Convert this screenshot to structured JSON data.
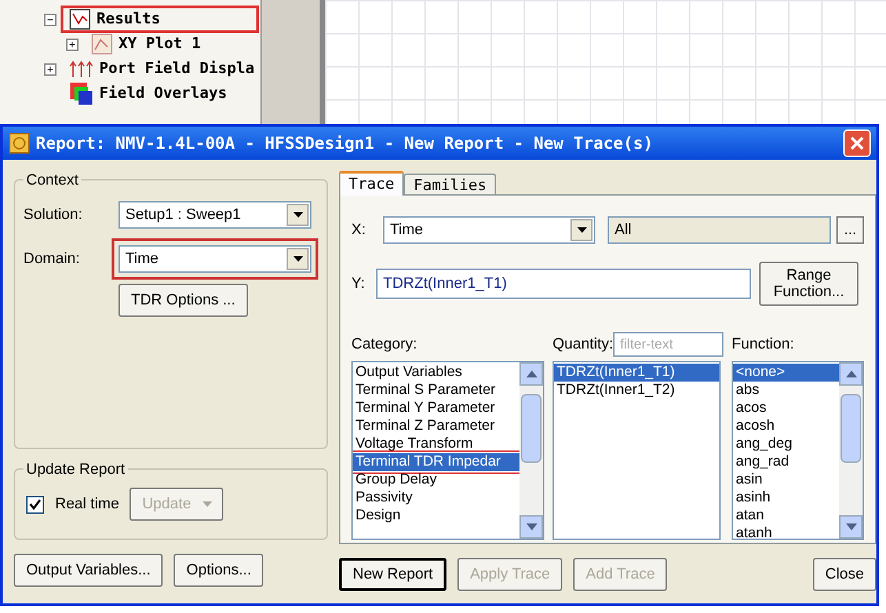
{
  "tree": {
    "items": [
      {
        "label": "Results",
        "expander": "−",
        "annotated": true,
        "kind": "results",
        "children": [
          {
            "label": "XY Plot 1",
            "expander": "+",
            "annotated": false,
            "kind": "plot"
          }
        ]
      },
      {
        "label": "Port Field Displa",
        "expander": "+",
        "annotated": false,
        "kind": "port"
      },
      {
        "label": "Field Overlays",
        "annotated": false,
        "kind": "overlay"
      }
    ]
  },
  "dialog": {
    "title": "Report: NMV-1.4L-00A - HFSSDesign1 - New Report - New Trace(s)",
    "context": {
      "title": "Context",
      "solution": {
        "label": "Solution:",
        "value": "Setup1 : Sweep1"
      },
      "domain": {
        "label": "Domain:",
        "value": "Time",
        "annotated": true
      },
      "tdr_button": "TDR Options ..."
    },
    "update": {
      "title": "Update Report",
      "realtime": {
        "label": "Real time",
        "checked": true
      },
      "update_button": {
        "label": "Update",
        "disabled": true
      }
    },
    "tabs": [
      {
        "label": "Trace",
        "selected": true
      },
      {
        "label": "Families",
        "selected": false
      }
    ],
    "x": {
      "label": "X:",
      "value": "Time",
      "range": "All",
      "more": "..."
    },
    "y": {
      "label": "Y:",
      "value": "TDRZt(Inner1_T1)",
      "range_button": "Range Function..."
    },
    "category": {
      "label": "Category:",
      "items": [
        {
          "label": "Output Variables",
          "selected": false,
          "annotated": false
        },
        {
          "label": "Terminal S Parameter",
          "selected": false,
          "annotated": false
        },
        {
          "label": "Terminal Y Parameter",
          "selected": false,
          "annotated": false
        },
        {
          "label": "Terminal Z Parameter",
          "selected": false,
          "annotated": false
        },
        {
          "label": "Voltage Transform",
          "selected": false,
          "annotated": false
        },
        {
          "label": "Terminal TDR Impedar",
          "selected": true,
          "annotated": true
        },
        {
          "label": "Group Delay",
          "selected": false,
          "annotated": false
        },
        {
          "label": "Passivity",
          "selected": false,
          "annotated": false
        },
        {
          "label": "Design",
          "selected": false,
          "annotated": false
        }
      ]
    },
    "quantity": {
      "label": "Quantity:",
      "placeholder": "filter-text",
      "items": [
        {
          "label": "TDRZt(Inner1_T1)",
          "selected": true
        },
        {
          "label": "TDRZt(Inner1_T2)",
          "selected": false
        }
      ]
    },
    "function": {
      "label": "Function:",
      "items": [
        {
          "label": "<none>",
          "selected": true
        },
        {
          "label": "abs",
          "selected": false
        },
        {
          "label": "acos",
          "selected": false
        },
        {
          "label": "acosh",
          "selected": false
        },
        {
          "label": "ang_deg",
          "selected": false
        },
        {
          "label": "ang_rad",
          "selected": false
        },
        {
          "label": "asin",
          "selected": false
        },
        {
          "label": "asinh",
          "selected": false
        },
        {
          "label": "atan",
          "selected": false
        },
        {
          "label": "atanh",
          "selected": false
        }
      ]
    },
    "left_buttons": [
      {
        "label": "Output Variables...",
        "disabled": false,
        "default": false
      },
      {
        "label": "Options...",
        "disabled": false,
        "default": false
      }
    ],
    "right_buttons": [
      {
        "label": "New Report",
        "disabled": false,
        "default": true
      },
      {
        "label": "Apply Trace",
        "disabled": true,
        "default": false
      },
      {
        "label": "Add Trace",
        "disabled": true,
        "default": false
      },
      {
        "label": "Close",
        "disabled": false,
        "default": false
      }
    ]
  }
}
